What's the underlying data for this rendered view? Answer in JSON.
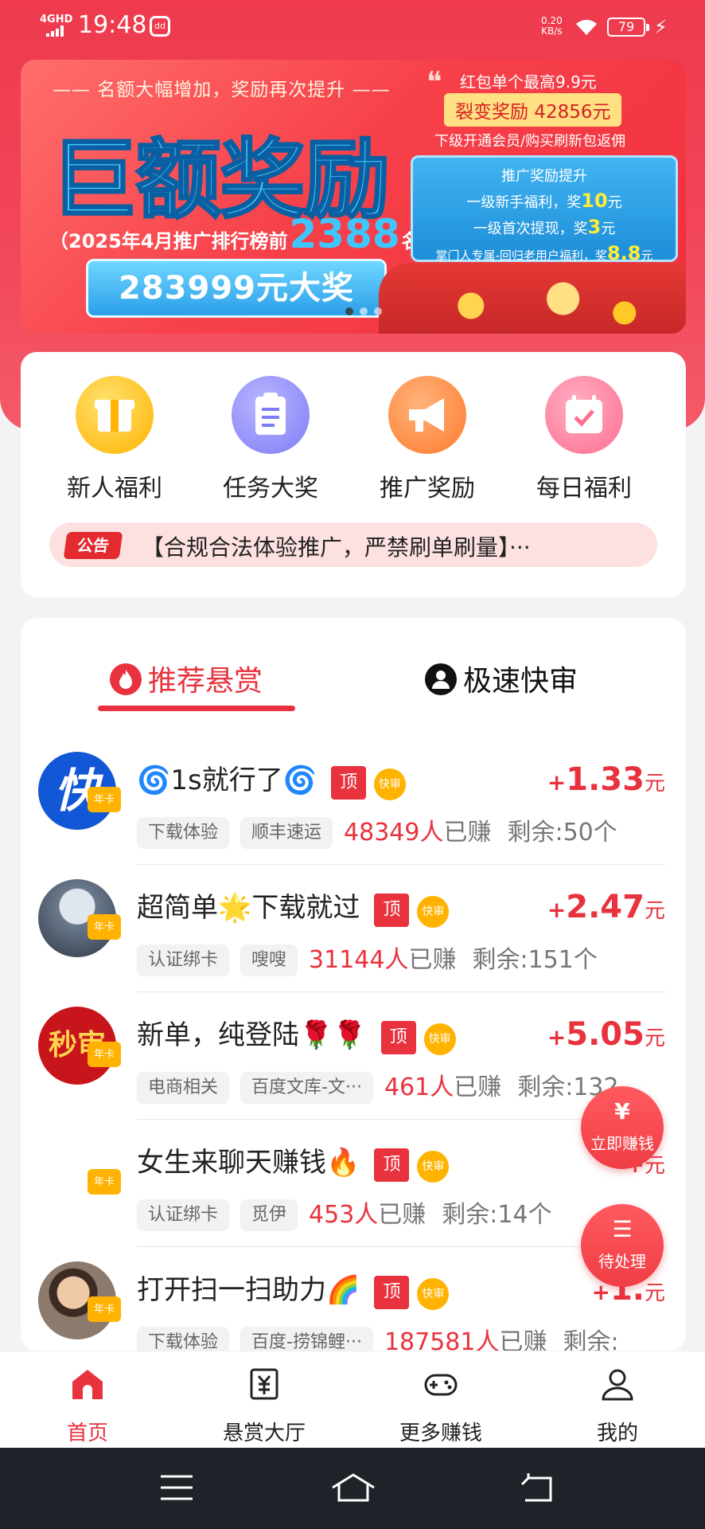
{
  "status_bar": {
    "network": "4GHD",
    "time": "19:48",
    "app_icon_text": "dd",
    "speed_value": "0.20",
    "speed_unit": "KB/s",
    "battery": "79"
  },
  "banner": {
    "subhead": "—— 名额大幅增加，奖励再次提升 ——",
    "headline": "巨额奖励",
    "rank_prefix": "（2025年4月推广排行榜前",
    "rank_number": "2388",
    "rank_suffix": "名）",
    "prize": "283999元大奖",
    "redpack_max": "红包单个最高9.9元",
    "fission_reward": "裂变奖励 42856元",
    "rebate_text": "下级开通会员/购买刷新包返佣",
    "promo": {
      "title": "推广奖励提升",
      "line1_pre": "一级新手福利，奖",
      "line1_num": "10",
      "line1_unit": "元",
      "line2_pre": "一级首次提现，奖",
      "line2_num": "3",
      "line2_unit": "元",
      "line3_pre": "掌门人专属-回归老用户福利，奖",
      "line3_num": "8.8",
      "line3_unit": "元"
    }
  },
  "categories": [
    {
      "label": "新人福利",
      "icon": "gift-icon",
      "color": "#ffb300"
    },
    {
      "label": "任务大奖",
      "icon": "clipboard-icon",
      "color": "#7e7cf6"
    },
    {
      "label": "推广奖励",
      "icon": "megaphone-icon",
      "color": "#ff7b2e"
    },
    {
      "label": "每日福利",
      "icon": "calendar-check-icon",
      "color": "#ff6f91"
    }
  ],
  "notice": {
    "tag": "公告",
    "text": "【合规合法体验推广，严禁刷单刷量】···"
  },
  "tabs": {
    "recommended": "推荐悬赏",
    "fast_review": "极速快审"
  },
  "badges": {
    "top": "顶",
    "fast": "快审",
    "annual": "年卡"
  },
  "tasks": [
    {
      "title": "1s就行了",
      "plus": "+",
      "amount": "1.33",
      "unit": "元",
      "chips": [
        "下载体验",
        "顺丰速运"
      ],
      "count": "48349人",
      "earned": "已赚",
      "remain": "剩余:50个",
      "avatar_text": "快"
    },
    {
      "title": "超简单🌟下载就过",
      "plus": "+",
      "amount": "2.47",
      "unit": "元",
      "chips": [
        "认证绑卡",
        "嗖嗖"
      ],
      "count": "31144人",
      "earned": "已赚",
      "remain": "剩余:151个",
      "avatar_text": ""
    },
    {
      "title": "新单，纯登陆🌹🌹",
      "plus": "+",
      "amount": "5.05",
      "unit": "元",
      "chips": [
        "电商相关",
        "百度文库-文···"
      ],
      "count": "461人",
      "earned": "已赚",
      "remain": "剩余:132",
      "avatar_text": "秒审"
    },
    {
      "title": "女生来聊天赚钱🔥",
      "plus": "+",
      "amount": "",
      "unit": "元",
      "chips": [
        "认证绑卡",
        "觅伊"
      ],
      "count": "453人",
      "earned": "已赚",
      "remain": "剩余:14个",
      "avatar_text": ""
    },
    {
      "title": "打开扫一扫助力🌈",
      "plus": "+",
      "amount": "1.",
      "unit": "元",
      "chips": [
        "下载体验",
        "百度-捞锦鲤···"
      ],
      "count": "187581人",
      "earned": "已赚",
      "remain": "剩余:",
      "avatar_text": ""
    }
  ],
  "floating": {
    "earn_now": "立即赚钱",
    "pending": "待处理"
  },
  "bottom_nav": [
    {
      "label": "首页",
      "icon": "home-icon",
      "active": true
    },
    {
      "label": "悬赏大厅",
      "icon": "bounty-hall-icon",
      "active": false
    },
    {
      "label": "更多赚钱",
      "icon": "gamepad-icon",
      "active": false
    },
    {
      "label": "我的",
      "icon": "profile-icon",
      "active": false
    }
  ],
  "colors": {
    "brand_red": "#e8323d",
    "gold": "#ffb300"
  }
}
